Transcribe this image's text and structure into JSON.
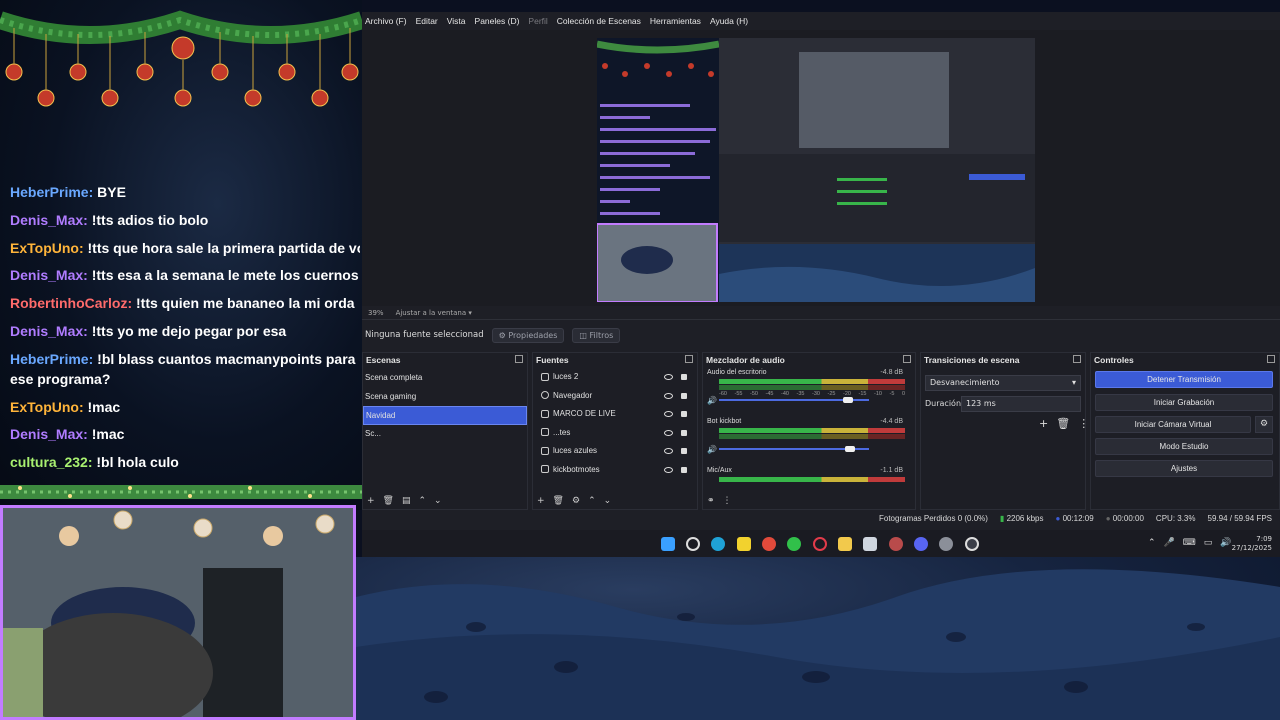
{
  "chat": {
    "messages": [
      {
        "user": "HeberPrime:",
        "text": "BYE",
        "color": "#6aa8ff"
      },
      {
        "user": "Denis_Max:",
        "text": "!tts adios tio bolo",
        "color": "#b07cff"
      },
      {
        "user": "ExTopUno:",
        "text": "!tts que hora sale la primera partida de voxizidota",
        "color": "#ffb43a"
      },
      {
        "user": "Denis_Max:",
        "text": "!tts esa a la semana le mete los cuernos",
        "color": "#b07cff"
      },
      {
        "user": "RobertinhoCarloz:",
        "text": "!tts quien me bananeo la mi orda",
        "color": "#ff6b6b"
      },
      {
        "user": "Denis_Max:",
        "text": "!tts yo me dejo pegar por esa",
        "color": "#b07cff"
      },
      {
        "user": "HeberPrime:",
        "text": "!bl blass cuantos macmanypoints para que part",
        "color": "#6aa8ff"
      },
      {
        "user": "",
        "text": "ese programa?",
        "color": "#ffffff"
      },
      {
        "user": "ExTopUno:",
        "text": "!mac",
        "color": "#ffb43a"
      },
      {
        "user": "Denis_Max:",
        "text": "!mac",
        "color": "#b07cff"
      },
      {
        "user": "cultura_232:",
        "text": "!bl hola culo",
        "color": "#a8f070"
      }
    ]
  },
  "obs": {
    "menu": [
      "Archivo (F)",
      "Editar",
      "Vista",
      "Paneles (D)",
      "Perfil",
      "Colección de Escenas",
      "Herramientas",
      "Ayuda (H)"
    ],
    "preview_bar": {
      "zoom": "39%",
      "fit": "Ajustar a la ventana"
    },
    "props": {
      "no_source": "Ninguna fuente seleccionad",
      "properties": "Propiedades",
      "filters": "Filtros"
    },
    "scenes": {
      "title": "Escenas",
      "items": [
        "Scena completa",
        "Scena gaming",
        "Navidad",
        "Sc..."
      ],
      "selected": 2
    },
    "sources": {
      "title": "Fuentes",
      "items": [
        "luces 2",
        "Navegador",
        "MARCO DE LIVE",
        "...tes",
        "luces azules",
        "kickbotmotes"
      ]
    },
    "mixer": {
      "title": "Mezclador de audio",
      "channels": [
        {
          "name": "Audio del escritorio",
          "db": "-4.8 dB",
          "volume": 0.78
        },
        {
          "name": "Bot kickbot",
          "db": "-4.4 dB",
          "volume": 0.8
        },
        {
          "name": "Mic/Aux",
          "db": "-1.1 dB",
          "volume": 0.9
        }
      ],
      "scale": [
        "-60",
        "-55",
        "-50",
        "-45",
        "-40",
        "-35",
        "-30",
        "-25",
        "-20",
        "-15",
        "-10",
        "-5",
        "0"
      ]
    },
    "transitions": {
      "title": "Transiciones de escena",
      "selected": "Desvanecimiento",
      "duration_label": "Duración",
      "duration_value": "123 ms"
    },
    "controls": {
      "title": "Controles",
      "buttons": [
        "Detener Transmisión",
        "Iniciar Grabación",
        "Iniciar Cámara Virtual",
        "Modo Estudio",
        "Ajustes"
      ]
    },
    "status": {
      "dropped": "Fotogramas Perdidos 0 (0.0%)",
      "bitrate": "2206 kbps",
      "live_time": "00:12:09",
      "rec_time": "00:00:00",
      "cpu": "CPU: 3.3%",
      "fps": "59.94 / 59.94 FPS"
    },
    "tray": {
      "time": "7:09",
      "date": "27/12/2025"
    }
  }
}
